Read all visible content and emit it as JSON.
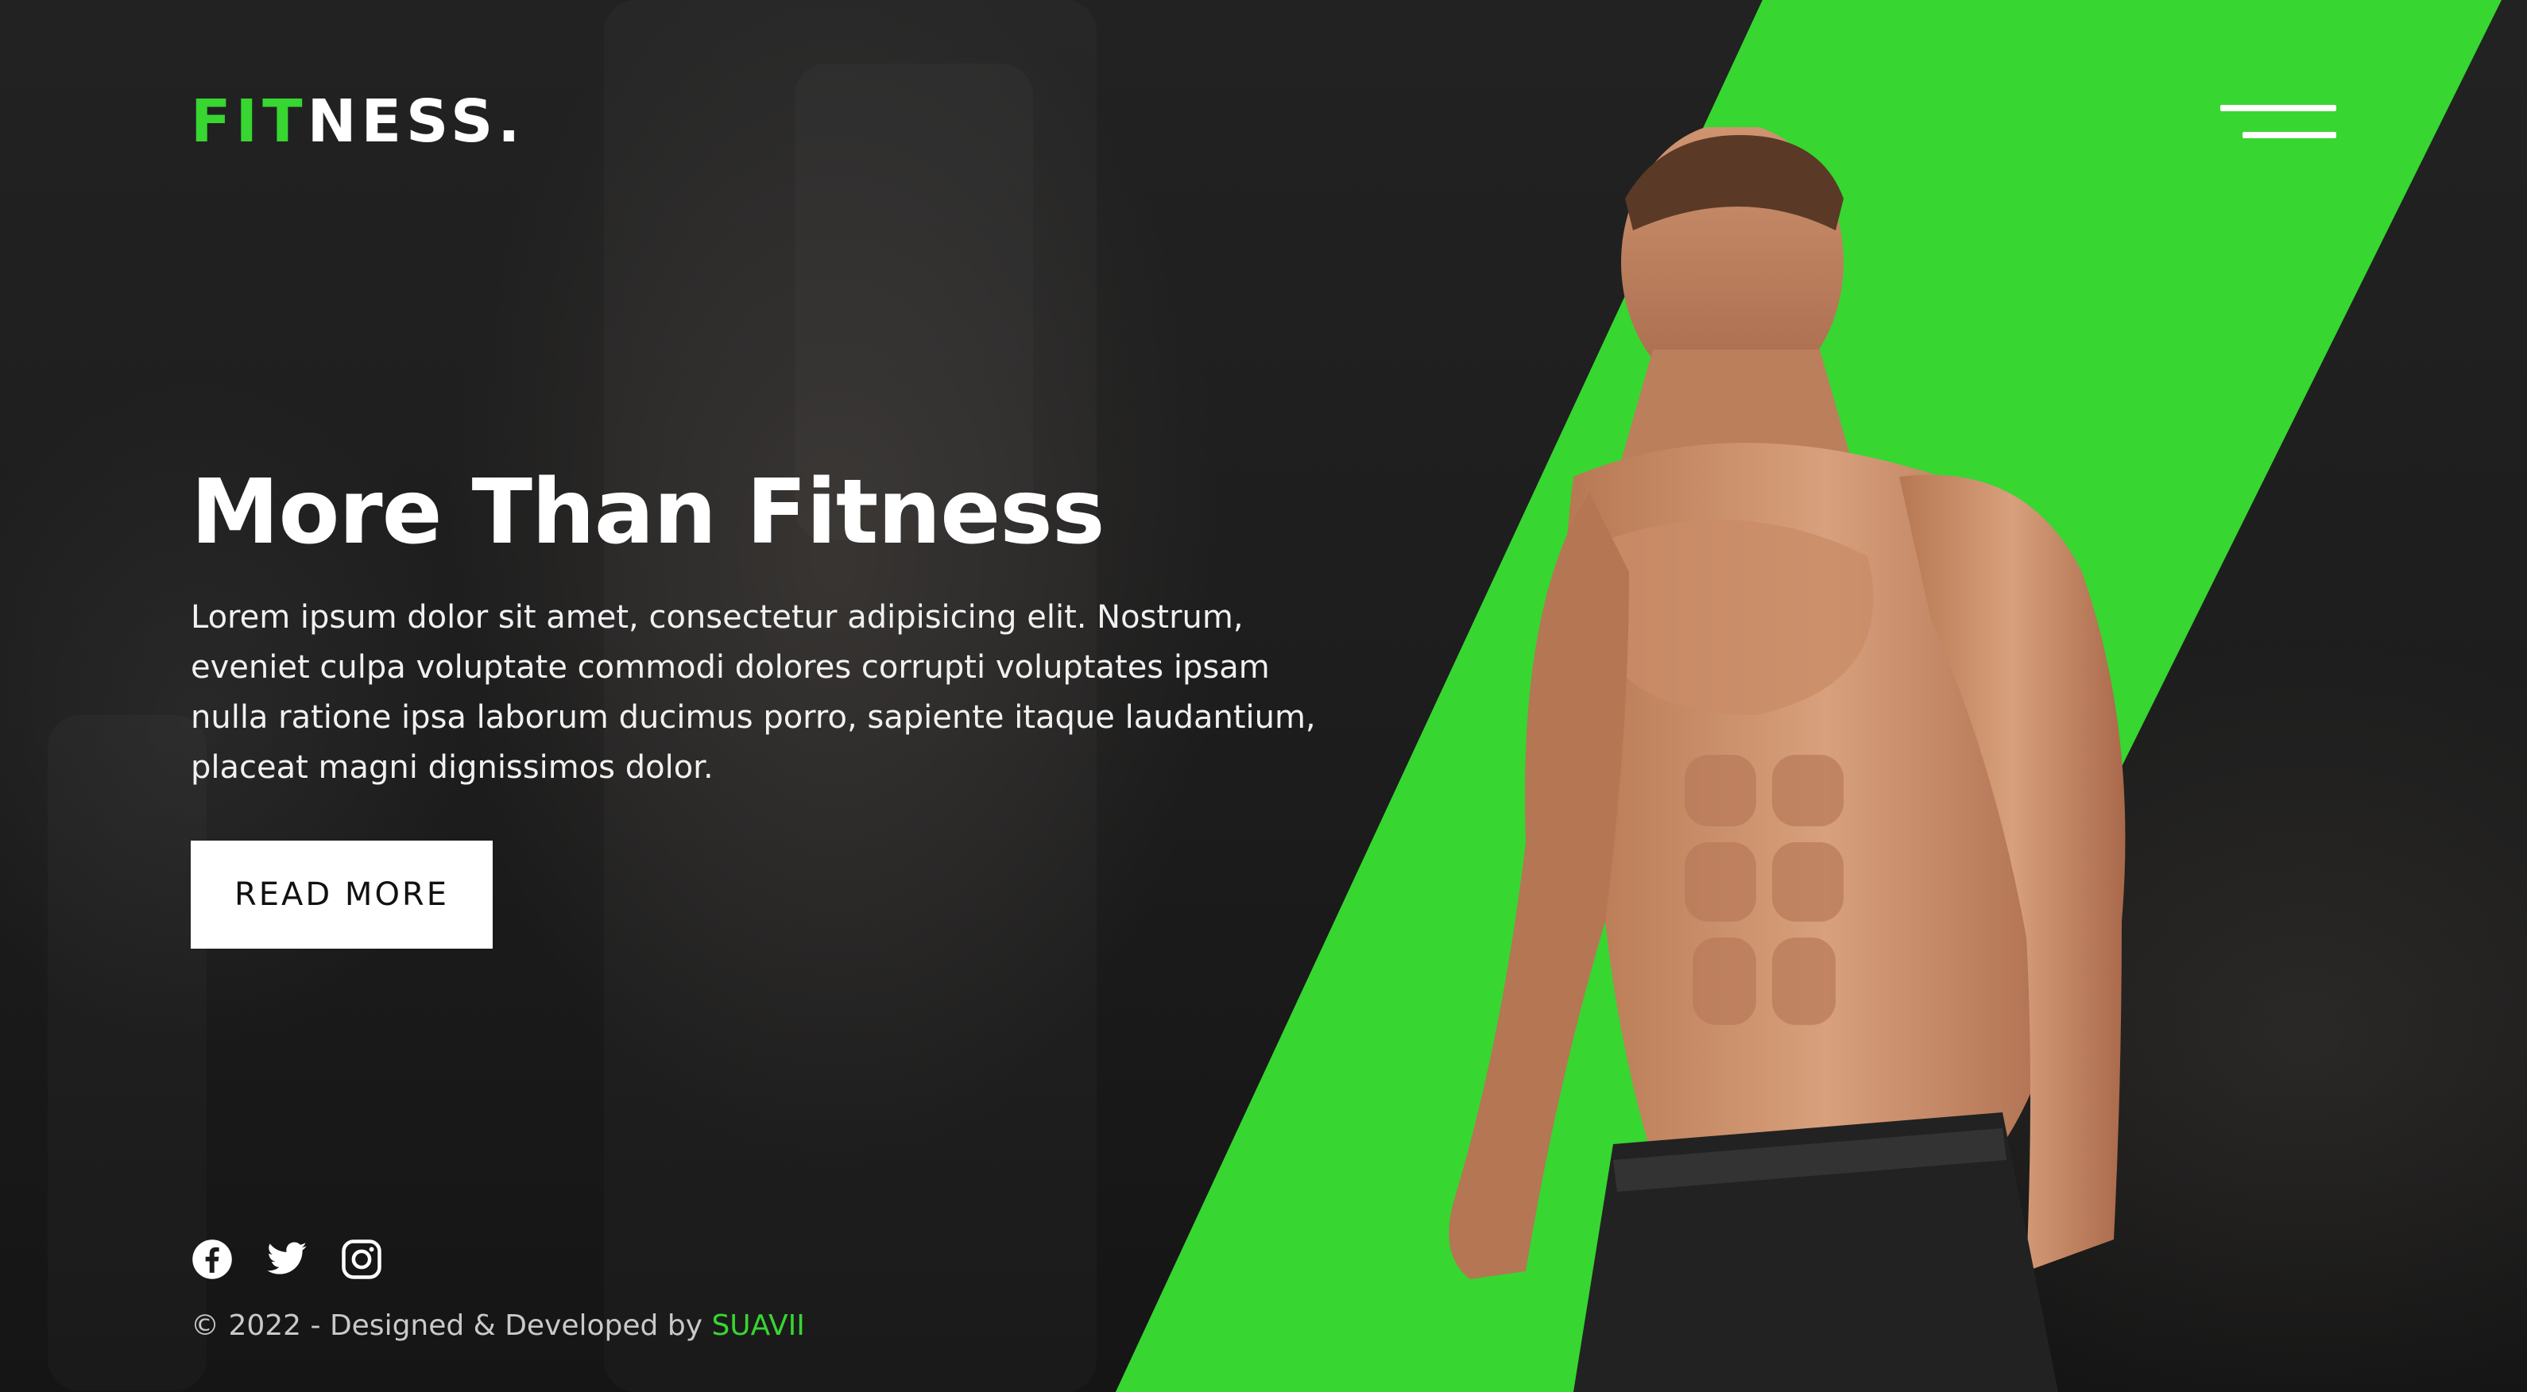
{
  "brand": {
    "logo_accent": "FIT",
    "logo_rest": "NESS."
  },
  "hero": {
    "title": "More Than Fitness",
    "description": "Lorem ipsum dolor sit amet, consectetur adipisicing elit. Nostrum, eveniet culpa voluptate commodi dolores corrupti voluptates ipsam nulla ratione ipsa laborum ducimus porro, sapiente itaque laudantium, placeat magni dignissimos dolor.",
    "cta_label": "READ MORE"
  },
  "social": [
    {
      "icon": "facebook-icon"
    },
    {
      "icon": "twitter-icon"
    },
    {
      "icon": "instagram-icon"
    }
  ],
  "footer": {
    "text": "© 2022 - Designed & Developed by ",
    "credit": "SUAVII"
  },
  "colors": {
    "accent": "#37d631",
    "background": "#1b1b1b",
    "text": "#ffffff",
    "button_bg": "#ffffff",
    "button_text": "#111111"
  },
  "icons": {
    "menu": "hamburger-menu-icon"
  }
}
